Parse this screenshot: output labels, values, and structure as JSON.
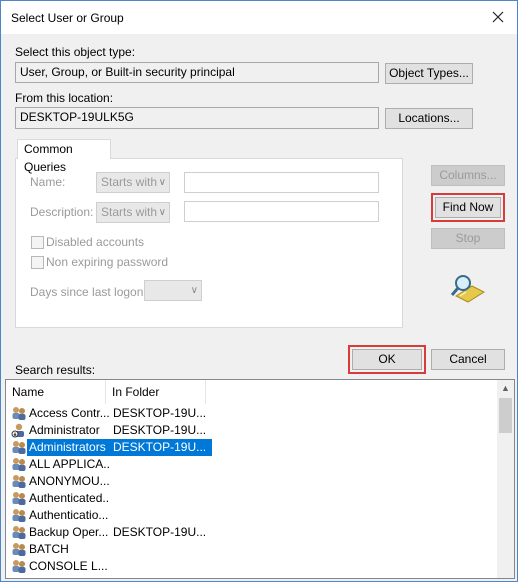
{
  "window": {
    "title": "Select User or Group"
  },
  "object_type": {
    "label": "Select this object type:",
    "value": "User, Group, or Built-in security principal",
    "button": "Object Types..."
  },
  "location": {
    "label": "From this location:",
    "value": "DESKTOP-19ULK5G",
    "button": "Locations..."
  },
  "common_queries": {
    "tab": "Common Queries",
    "name_label": "Name:",
    "name_mode": "Starts with",
    "description_label": "Description:",
    "description_mode": "Starts with",
    "disabled_accounts": "Disabled accounts",
    "non_expiring": "Non expiring password",
    "days_label": "Days since last logon:"
  },
  "side_buttons": {
    "columns": "Columns...",
    "find_now": "Find Now",
    "stop": "Stop"
  },
  "actions": {
    "ok": "OK",
    "cancel": "Cancel"
  },
  "results": {
    "label": "Search results:",
    "columns": [
      "Name",
      "In Folder"
    ],
    "rows": [
      {
        "name": "Access Contr...",
        "folder": "DESKTOP-19U...",
        "icon": "group-icon"
      },
      {
        "name": "Administrator",
        "folder": "DESKTOP-19U...",
        "icon": "user-icon"
      },
      {
        "name": "Administrators",
        "folder": "DESKTOP-19U...",
        "icon": "group-icon"
      },
      {
        "name": "ALL APPLICA...",
        "folder": "",
        "icon": "group-icon"
      },
      {
        "name": "ANONYMOU...",
        "folder": "",
        "icon": "group-icon"
      },
      {
        "name": "Authenticated...",
        "folder": "",
        "icon": "group-icon"
      },
      {
        "name": "Authenticatio...",
        "folder": "",
        "icon": "group-icon"
      },
      {
        "name": "Backup Oper...",
        "folder": "DESKTOP-19U...",
        "icon": "group-icon"
      },
      {
        "name": "BATCH",
        "folder": "",
        "icon": "group-icon"
      },
      {
        "name": "CONSOLE L...",
        "folder": "",
        "icon": "group-icon"
      }
    ],
    "selected_index": 2
  },
  "colors": {
    "highlight": "#0078d7",
    "callout": "#d93a3a"
  }
}
